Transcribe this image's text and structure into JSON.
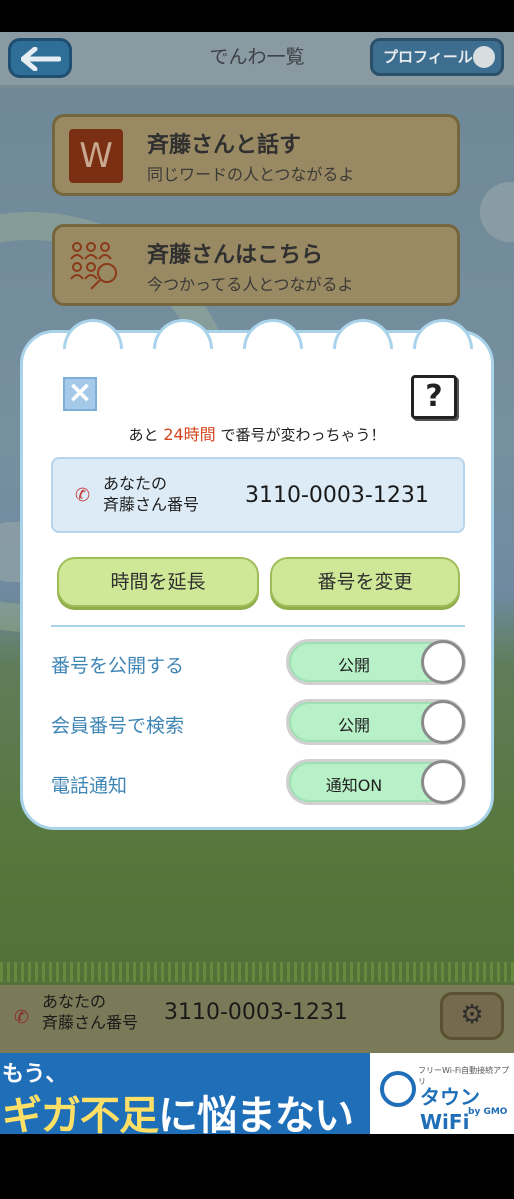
{
  "header": {
    "title": "でんわ一覧",
    "profile_label": "プロフィール"
  },
  "menu": {
    "items": [
      {
        "title": "斉藤さんと話す",
        "subtitle": "同じワードの人とつながるよ",
        "icon": "W"
      },
      {
        "title": "斉藤さんはこちら",
        "subtitle": "今つかってる人とつながるよ",
        "icon": "people-search-icon"
      }
    ]
  },
  "dialog": {
    "notice_before": "あと",
    "notice_hours": "24時間",
    "notice_after": "で番号が変わっちゃう！",
    "number_label_line1": "あなたの",
    "number_label_line2": "斉藤さん番号",
    "number": "3110-0003-1231",
    "extend_button": "時間を延長",
    "change_button": "番号を変更",
    "settings": [
      {
        "label": "番号を公開する",
        "value": "公開",
        "on": true
      },
      {
        "label": "会員番号で検索",
        "value": "公開",
        "on": true
      },
      {
        "label": "電話通知",
        "value": "通知ON",
        "on": true
      }
    ],
    "help_label": "?",
    "close_label": "×"
  },
  "bottom_bar": {
    "label_line1": "あなたの",
    "label_line2": "斉藤さん番号",
    "number": "3110-0003-1231"
  },
  "ad": {
    "line1": "もう、",
    "line2_a": "ギガ不足",
    "line2_b": "に",
    "line2_c": "悩まない",
    "brand": "タウンWiFi",
    "tagline": "フリーWi-Fi自動接続アプリ",
    "by": "by GMO"
  },
  "colors": {
    "accent_blue": "#3f86b5",
    "hours_red": "#d6451d",
    "toggle_green": "#b8f0c8",
    "button_green": "#cfe898"
  }
}
